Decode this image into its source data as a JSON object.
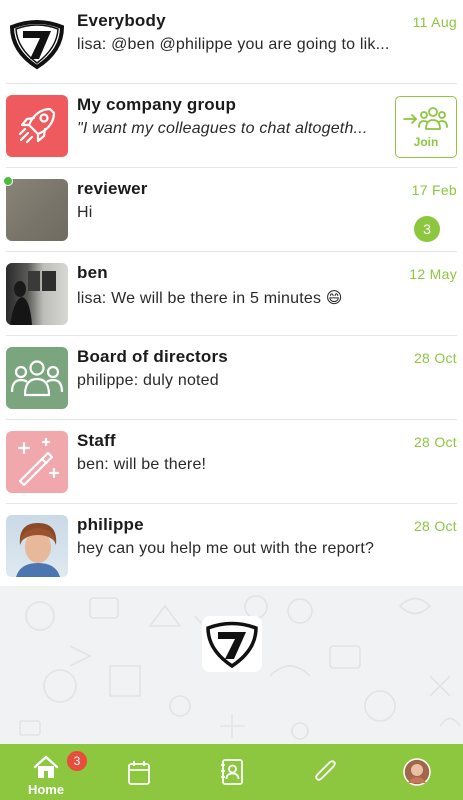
{
  "conversations": [
    {
      "name": "Everybody",
      "message": "lisa: @ben @philippe you are going to lik...",
      "date": "11 Aug",
      "avatar": "seven-logo-icon"
    },
    {
      "name": "My company group",
      "message": "\"I want my colleagues to chat altogeth...",
      "action": "Join",
      "avatar": "rocket-icon",
      "avatar_color": "#ef5a5f"
    },
    {
      "name": "reviewer",
      "message": "Hi",
      "date": "17 Feb",
      "unread": "3",
      "avatar": "gray-photo",
      "online": true
    },
    {
      "name": "ben",
      "message": "lisa: We will be there in 5 minutes 😄",
      "date": "12 May",
      "avatar": "room-photo"
    },
    {
      "name": "Board of directors",
      "message": "philippe: duly noted",
      "date": "28 Oct",
      "avatar": "group-icon",
      "avatar_color": "#7aa57e"
    },
    {
      "name": "Staff",
      "message": "ben: will be there!",
      "date": "28 Oct",
      "avatar": "magic-wand-icon",
      "avatar_color": "#f0a8ad"
    },
    {
      "name": "philippe",
      "message": "hey can you help me out with the report?",
      "date": "28 Oct",
      "avatar": "person-photo"
    }
  ],
  "tabbar": {
    "home_label": "Home",
    "home_badge": "3",
    "tabs": [
      "home-icon",
      "calendar-icon",
      "contacts-icon",
      "attachment-icon",
      "profile-avatar"
    ]
  },
  "colors": {
    "accent": "#8dc63f",
    "badge": "#e74c3c",
    "divider": "#e6e6e6"
  }
}
